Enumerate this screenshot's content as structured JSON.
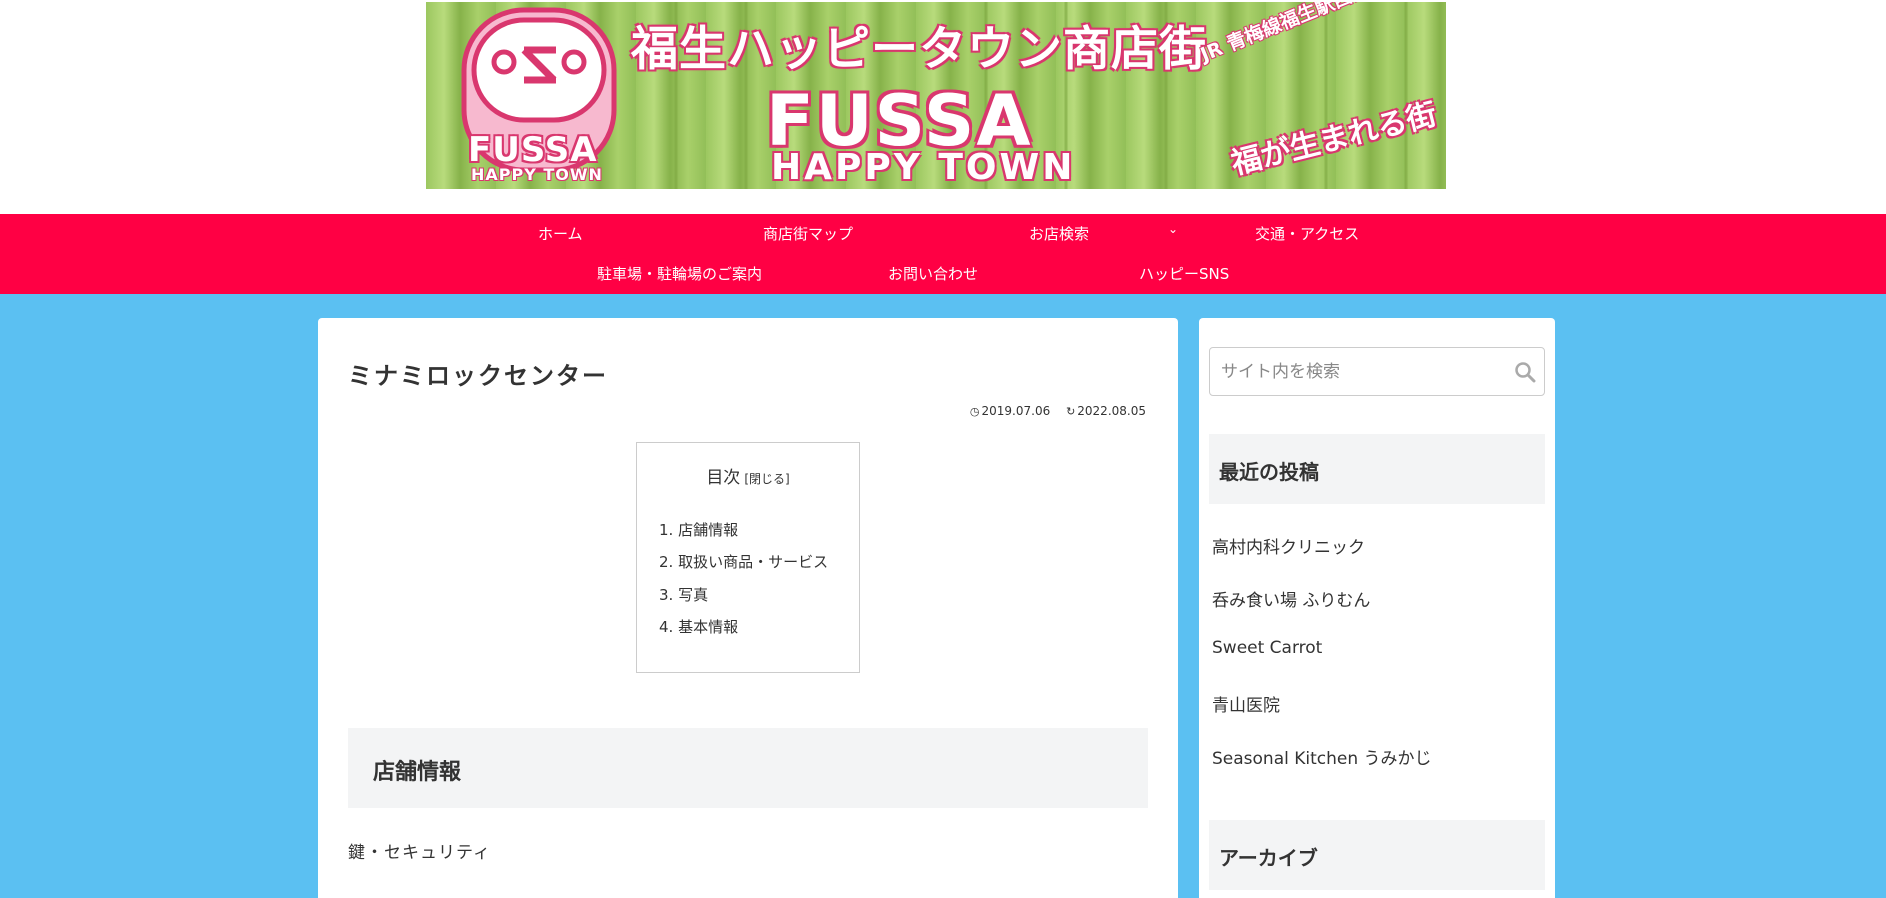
{
  "banner": {
    "title_jp": "福生ハッピータウン商店街",
    "logo_fussa": "FUSSA",
    "logo_happy": "HAPPY TOWN",
    "big_fussa": "FUSSA",
    "big_happy": "HAPPY TOWN",
    "jr_text": "JR 青梅線福生駅西口",
    "slogan": "福が生まれる街"
  },
  "nav": {
    "items": [
      {
        "label": "ホーム"
      },
      {
        "label": "商店街マップ"
      },
      {
        "label": "お店検索"
      },
      {
        "label": "交通・アクセス"
      },
      {
        "label": "駐車場・駐輪場のご案内"
      },
      {
        "label": "お問い合わせ"
      },
      {
        "label": "ハッピーSNS"
      }
    ],
    "chevron": "⌄"
  },
  "article": {
    "title": "ミナミロックセンター",
    "published": "2019.07.06",
    "updated": "2022.08.05",
    "toc": {
      "title": "目次",
      "toggle": "[閉じる]",
      "items": [
        "1. 店舗情報",
        "2. 取扱い商品・サービス",
        "3. 写真",
        "4. 基本情報"
      ]
    },
    "section_heading": "店舗情報",
    "body_text": "鍵・セキュリティ"
  },
  "sidebar": {
    "search_placeholder": "サイト内を検索",
    "recent_heading": "最近の投稿",
    "recent_posts": [
      "高村内科クリニック",
      "呑み食い場 ふりむん",
      "Sweet Carrot",
      "青山医院",
      "Seasonal Kitchen うみかじ"
    ],
    "archive_heading": "アーカイブ"
  },
  "colors": {
    "nav_bg": "#ff0044",
    "page_bg": "#5bc0f2",
    "banner_pink": "#d9376e",
    "banner_green": "#9cc760"
  },
  "icons": {
    "published": "clock-icon",
    "updated": "history-icon",
    "search": "search-icon"
  }
}
